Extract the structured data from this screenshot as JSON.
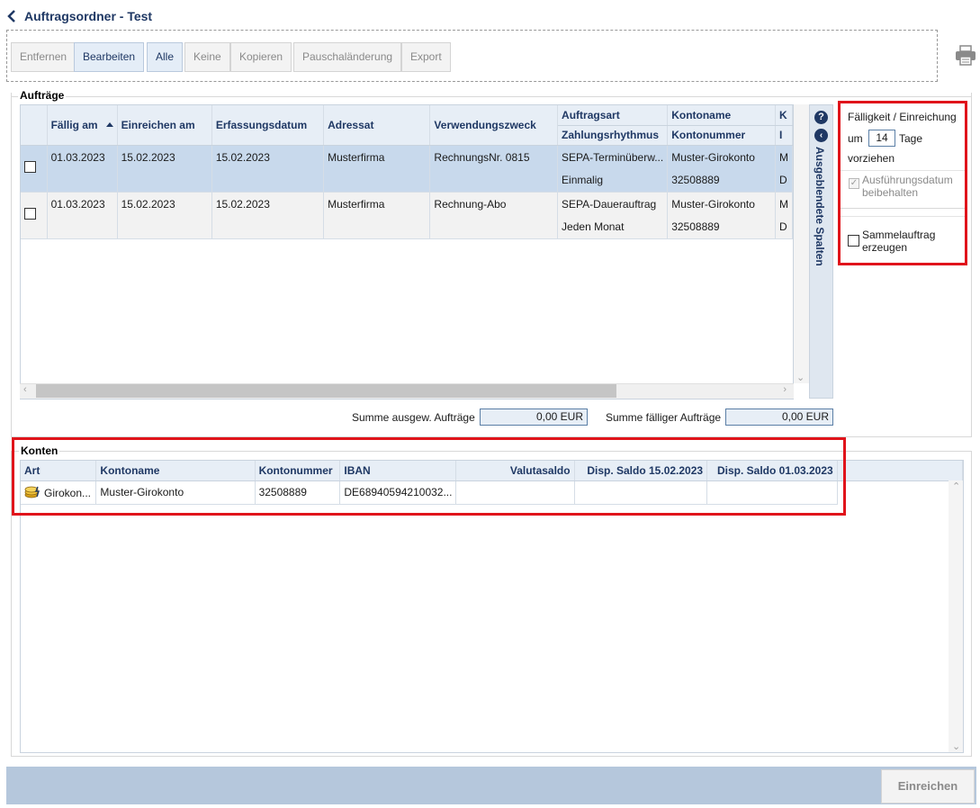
{
  "header": {
    "title": "Auftragsordner - Test"
  },
  "toolbar": {
    "buttons": [
      {
        "label": "Entfernen"
      },
      {
        "label": "Bearbeiten"
      },
      {
        "label": "Alle"
      },
      {
        "label": "Keine"
      },
      {
        "label": "Kopieren"
      },
      {
        "label": "Pauschaländerung"
      },
      {
        "label": "Export"
      }
    ]
  },
  "auftraege": {
    "section_label": "Aufträge",
    "columns": {
      "faellig": "Fällig am",
      "einreichen": "Einreichen am",
      "erfassung": "Erfassungsdatum",
      "adressat": "Adressat",
      "zweck": "Verwendungszweck",
      "auftragsart": "Auftragsart",
      "zahlungsrhythmus": "Zahlungsrhythmus",
      "kontoname": "Kontoname",
      "kontonummer": "Kontonummer",
      "k_top": "K",
      "k_bottom": "I"
    },
    "rows": [
      {
        "faellig": "01.03.2023",
        "einreichen": "15.02.2023",
        "erfassung": "15.02.2023",
        "adressat": "Musterfirma",
        "zweck": "RechnungsNr. 0815",
        "auftragsart": "SEPA-Terminüberw...",
        "zahlungsrhythmus": "Einmalig",
        "kontoname": "Muster-Girokonto",
        "kontonummer": "32508889",
        "k_top": "M",
        "k_bottom": "D"
      },
      {
        "faellig": "01.03.2023",
        "einreichen": "15.02.2023",
        "erfassung": "15.02.2023",
        "adressat": "Musterfirma",
        "zweck": "Rechnung-Abo",
        "auftragsart": "SEPA-Dauerauftrag",
        "zahlungsrhythmus": "Jeden Monat",
        "kontoname": "Muster-Girokonto",
        "kontonummer": "32508889",
        "k_top": "M",
        "k_bottom": "D"
      }
    ],
    "side_label": "Ausgeblendete Spalten",
    "sum_selected_label": "Summe ausgew. Aufträge",
    "sum_selected_value": "0,00 EUR",
    "sum_due_label": "Summe fälliger Aufträge",
    "sum_due_value": "0,00 EUR"
  },
  "options": {
    "title": "Fälligkeit / Einreichung",
    "um": "um",
    "days": "14",
    "tage": "Tage",
    "vorziehen": "vorziehen",
    "keep_date": "Ausführungsdatum beibehalten",
    "sammel": "Sammelauftrag erzeugen"
  },
  "konten": {
    "section_label": "Konten",
    "columns": {
      "art": "Art",
      "kontoname": "Kontoname",
      "kontonummer": "Kontonummer",
      "iban": "IBAN",
      "valutasaldo": "Valutasaldo",
      "disp1": "Disp. Saldo 15.02.2023",
      "disp2": "Disp. Saldo 01.03.2023"
    },
    "rows": [
      {
        "art": "Girokon...",
        "kontoname": "Muster-Girokonto",
        "kontonummer": "32508889",
        "iban": "DE68940594210032...",
        "valutasaldo": "",
        "disp1": "",
        "disp2": ""
      }
    ]
  },
  "footer": {
    "submit": "Einreichen"
  },
  "colors": {
    "accent": "#1f3864",
    "highlight": "#e0141b",
    "selected_row": "#c8d9ec"
  }
}
